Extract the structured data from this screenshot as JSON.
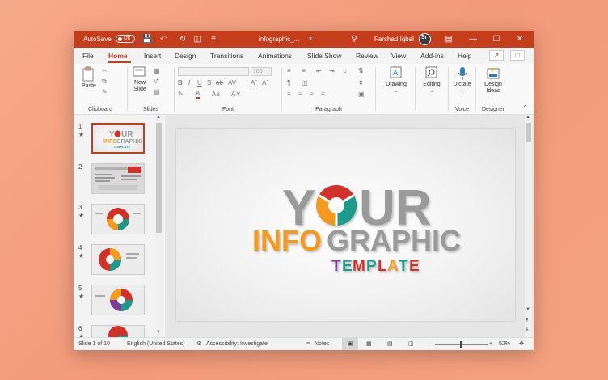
{
  "titlebar": {
    "autosave_label": "AutoSave",
    "autosave_state": "Off",
    "filename": "infographic_...",
    "user": "Farshad Iqbal",
    "avatar_text": "Sı"
  },
  "menu": {
    "tabs": [
      "File",
      "Home",
      "Insert",
      "Design",
      "Transitions",
      "Animations",
      "Slide Show",
      "Review",
      "View",
      "Add-ins",
      "Help"
    ],
    "active": "Home"
  },
  "ribbon": {
    "clipboard": {
      "paste": "Paste",
      "label": "Clipboard"
    },
    "slides": {
      "new_slide_line1": "New",
      "new_slide_line2": "Slide",
      "label": "Slides"
    },
    "font": {
      "size": "100",
      "label": "Font"
    },
    "paragraph": {
      "label": "Paragraph"
    },
    "drawing": {
      "label": "Drawing"
    },
    "editing": {
      "label": "Editing"
    },
    "voice": {
      "dictate": "Dictate",
      "label": "Voice"
    },
    "designer": {
      "ideas_line1": "Design",
      "ideas_line2": "Ideas",
      "label": "Designer"
    }
  },
  "thumbnails": [
    {
      "num": "1",
      "star": "★",
      "selected": true
    },
    {
      "num": "2",
      "star": "",
      "selected": false
    },
    {
      "num": "3",
      "star": "★",
      "selected": false
    },
    {
      "num": "4",
      "star": "★",
      "selected": false
    },
    {
      "num": "5",
      "star": "★",
      "selected": false
    },
    {
      "num": "6",
      "star": "★",
      "selected": false
    }
  ],
  "slide": {
    "word1_a": "Y",
    "word1_b": "UR",
    "word2_a": "INFO",
    "word2_b": "GRAPHIC",
    "word3_letters": [
      "T",
      "E",
      "M",
      "P",
      "L",
      "A",
      "T",
      "E"
    ]
  },
  "status": {
    "slide_count": "Slide 1 of 10",
    "language": "English (United States)",
    "accessibility": "Accessibility: Investigate",
    "notes": "Notes",
    "zoom": "52%"
  },
  "colors": {
    "accent": "#c43e1c",
    "orange": "#f59a1b",
    "teal": "#1b9a8a",
    "red": "#d3302a",
    "gray_text": "#9a9a9a"
  }
}
